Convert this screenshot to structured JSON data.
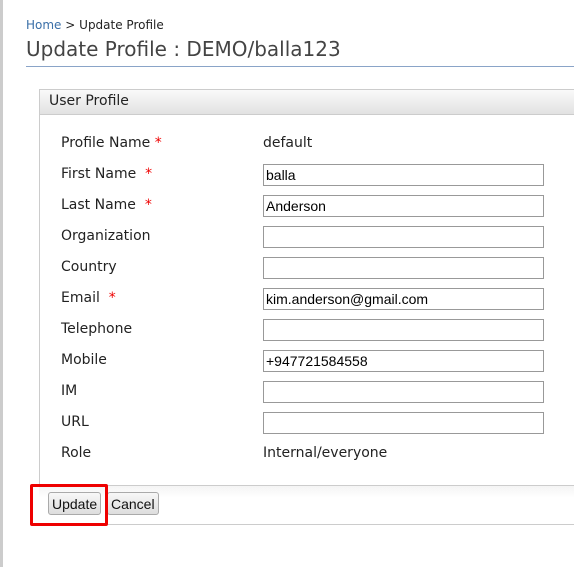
{
  "breadcrumb": {
    "home": "Home",
    "separator": ">",
    "current": "Update Profile"
  },
  "title": "Update Profile : DEMO/balla123",
  "panel": {
    "title": "User Profile"
  },
  "required_mark": "*",
  "fields": [
    {
      "label": "Profile Name",
      "required": true,
      "type": "text",
      "value": "default"
    },
    {
      "label": "First Name",
      "required": true,
      "type": "input",
      "value": "balla"
    },
    {
      "label": "Last Name",
      "required": true,
      "type": "input",
      "value": "Anderson"
    },
    {
      "label": "Organization",
      "required": false,
      "type": "input",
      "value": ""
    },
    {
      "label": "Country",
      "required": false,
      "type": "input",
      "value": ""
    },
    {
      "label": "Email",
      "required": true,
      "type": "input",
      "value": "kim.anderson@gmail.com"
    },
    {
      "label": "Telephone",
      "required": false,
      "type": "input",
      "value": ""
    },
    {
      "label": "Mobile",
      "required": false,
      "type": "input",
      "value": "+947721584558"
    },
    {
      "label": "IM",
      "required": false,
      "type": "input",
      "value": ""
    },
    {
      "label": "URL",
      "required": false,
      "type": "input",
      "value": ""
    },
    {
      "label": "Role",
      "required": false,
      "type": "text",
      "value": "Internal/everyone"
    }
  ],
  "buttons": {
    "update": "Update",
    "cancel": "Cancel"
  },
  "highlight_color": "#ee0000"
}
